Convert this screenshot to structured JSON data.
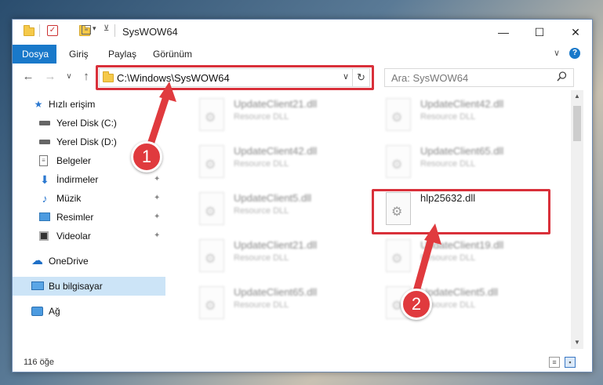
{
  "window": {
    "title": "SysWOW64",
    "controls": {
      "minimize": "—",
      "maximize": "☐",
      "close": "✕"
    }
  },
  "ribbon": {
    "tabs": [
      {
        "label": "Dosya",
        "active": true
      },
      {
        "label": "Giriş"
      },
      {
        "label": "Paylaş"
      },
      {
        "label": "Görünüm"
      }
    ],
    "expand_glyph": "∨",
    "help_glyph": "?"
  },
  "nav": {
    "back": "←",
    "forward": "→",
    "recent": "∨",
    "up": "↑",
    "address": "C:\\Windows\\SysWOW64",
    "address_dropdown": "∨",
    "refresh": "↻",
    "search_placeholder": "Ara: SysWOW64",
    "search_icon": "search-icon"
  },
  "sidebar": {
    "items": [
      {
        "label": "Hızlı erişim",
        "icon": "star-icon",
        "glyph": "★",
        "color": "#2b78d0"
      },
      {
        "label": "Yerel Disk (C:)",
        "icon": "drive-icon",
        "glyph": "▬",
        "color": "#555",
        "pin": ""
      },
      {
        "label": "Yerel Disk (D:)",
        "icon": "drive-icon",
        "glyph": "▬",
        "color": "#555",
        "pin": ""
      },
      {
        "label": "Belgeler",
        "icon": "documents-icon",
        "glyph": "▤",
        "color": "#555",
        "pin": ""
      },
      {
        "label": "İndirmeler",
        "icon": "download-icon",
        "glyph": "⬇",
        "color": "#2b78d0",
        "pin": "📌"
      },
      {
        "label": "Müzik",
        "icon": "music-icon",
        "glyph": "♪",
        "color": "#2b78d0",
        "pin": "📌"
      },
      {
        "label": "Resimler",
        "icon": "pictures-icon",
        "glyph": "▣",
        "color": "#3a8fd6",
        "pin": "📌"
      },
      {
        "label": "Videolar",
        "icon": "videos-icon",
        "glyph": "▦",
        "color": "#444",
        "pin": "📌"
      },
      {
        "label": "OneDrive",
        "icon": "onedrive-icon",
        "glyph": "☁",
        "color": "#1e6fc7"
      },
      {
        "label": "Bu bilgisayar",
        "icon": "computer-icon",
        "glyph": "▭",
        "color": "#2b78d0",
        "selected": true
      },
      {
        "label": "Ağ",
        "icon": "network-icon",
        "glyph": "⊞",
        "color": "#2b78d0"
      }
    ]
  },
  "files": [
    {
      "name": "UpdateClient21.dll",
      "type": "Resource DLL",
      "blur": true
    },
    {
      "name": "UpdateClient42.dll",
      "type": "Resource DLL",
      "blur": true
    },
    {
      "name": "UpdateClient42.dll",
      "type": "Resource DLL",
      "blur": true
    },
    {
      "name": "UpdateClient65.dll",
      "type": "Resource DLL",
      "blur": true
    },
    {
      "name": "UpdateClient5.dll",
      "type": "Resource DLL",
      "blur": true
    },
    {
      "name": "hlp25632.dll",
      "type": "",
      "blur": false
    },
    {
      "name": "UpdateClient21.dll",
      "type": "Resource DLL",
      "blur": true
    },
    {
      "name": "UpdateClient19.dll",
      "type": "Resource DLL",
      "blur": true
    },
    {
      "name": "UpdateClient65.dll",
      "type": "Resource DLL",
      "blur": true
    },
    {
      "name": "UpdateClient5.dll",
      "type": "Resource DLL",
      "blur": true
    }
  ],
  "status": {
    "count": "116 öğe"
  },
  "annotations": {
    "badge1": "1",
    "badge2": "2",
    "color": "#d9303a"
  }
}
